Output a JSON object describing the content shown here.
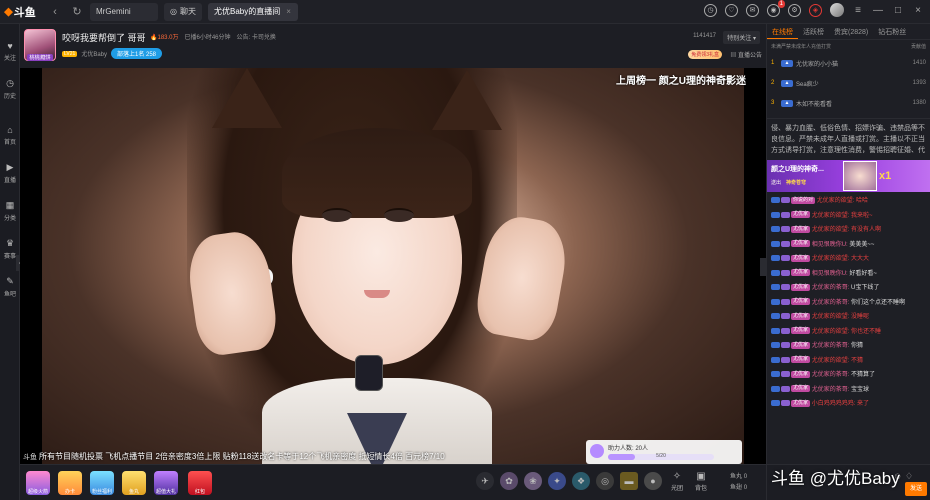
{
  "titlebar": {
    "app": "斗鱼",
    "tabs": [
      {
        "label": "MrGemini"
      },
      {
        "label": "聊天"
      },
      {
        "label": "尤优Baby的直播间"
      }
    ]
  },
  "sidebar": {
    "items": [
      {
        "icon": "follow-icon",
        "label": "关注"
      },
      {
        "icon": "history-icon",
        "label": "历史"
      },
      {
        "icon": "home-icon",
        "label": "首页"
      },
      {
        "icon": "live-icon",
        "label": "直播"
      },
      {
        "icon": "category-icon",
        "label": "分类"
      },
      {
        "icon": "trophy-icon",
        "label": "赛事"
      },
      {
        "icon": "fishbar-icon",
        "label": "鱼吧"
      }
    ]
  },
  "header": {
    "title": "咬呀我要帮倒了 哥哥",
    "follow": "关注",
    "heat": "183.0万",
    "duration": "已播6小时46分钟",
    "announcement": "公告: 卡司兑换",
    "streamer": "尤优Baby",
    "level_badge": "LV21",
    "hour_rank": "部落上1名 258",
    "room_id": "1141417",
    "special_follow": "特别关注",
    "gift_tag": "免费领3礼盒",
    "live_notice": "直播公告",
    "avatar_label": "桃桃|糖饼"
  },
  "video": {
    "weekly": "上周榜一 颜之U理的神奇影迷",
    "ticker_prefix": "斗鱼",
    "ticker": "所有节目随机投票 飞机点播节目 2倍亲密度3倍上限 贴粉118送改名卡等于12个飞机亲密度 抵短情长4倍 百元榜7/10",
    "popup_title": "助力人数: 20人",
    "popup_progress_text": "5/20",
    "popup_progress": 0.25
  },
  "bottombar": {
    "gifts": [
      {
        "label": "超级火箭"
      },
      {
        "label": "办卡"
      },
      {
        "label": "粉丝福利"
      },
      {
        "label": "鱼丸"
      },
      {
        "label": "超值大礼"
      },
      {
        "label": "红包"
      }
    ],
    "tools": [
      {
        "label": "光团"
      },
      {
        "label": "背包"
      }
    ],
    "cash_label": "鱼丸",
    "cash_value": "0",
    "coin_label": "鱼翅",
    "coin_value": "0"
  },
  "rightpanel": {
    "tabs": [
      "在线榜",
      "活跃榜",
      "贵宾(2828)",
      "钻石粉丝"
    ],
    "rank_header": "未满严禁未成年人充值打赏",
    "rank_contrib_label": "贡献值",
    "ranks": [
      {
        "no": "1",
        "name": "尤优家的小小猫",
        "value": "1410"
      },
      {
        "no": "2",
        "name": "Sea疯少",
        "value": "1393"
      },
      {
        "no": "3",
        "name": "木如不能看看",
        "value": "1380"
      }
    ],
    "notice": "侵、暴力血腥、低俗色情、招嫖诈骗、违禁品等不良信息。严禁未成年人直播或打赏。主播以不正当方式诱导打赏，注意理性消费，警惕招聘征婚、代",
    "banner": {
      "title": "颜之U理的神奇...",
      "sub1": "送出",
      "sub2": "神奇苍穹",
      "mult": "x1"
    },
    "chat": [
      {
        "fans": "你说的对",
        "name": "尤优家的欲望:",
        "text": "哈哈",
        "red": true
      },
      {
        "fans": "尤优家",
        "name": "尤优家的欲望:",
        "text": "我来啦~",
        "red": true
      },
      {
        "fans": "尤优家",
        "name": "尤优家的欲望:",
        "text": "有没有人啊",
        "red": true
      },
      {
        "fans": "尤优家",
        "name": "相见恨晚你U:",
        "text": "美美美~~",
        "red": false
      },
      {
        "fans": "尤优家",
        "name": "尤优家的欲望:",
        "text": "大大大",
        "red": true
      },
      {
        "fans": "尤优家",
        "name": "相见恨晚你U:",
        "text": "好看好看~",
        "red": false
      },
      {
        "fans": "尤优家",
        "name": "尤优家的茶哥:",
        "text": "U宝下线了",
        "red": false
      },
      {
        "fans": "尤优家",
        "name": "尤优家的茶哥:",
        "text": "你们这个点还不睡啊",
        "red": false
      },
      {
        "fans": "尤优家",
        "name": "尤优家的欲望:",
        "text": "没睡呢",
        "red": true
      },
      {
        "fans": "尤优家",
        "name": "尤优家的欲望:",
        "text": "你也还不睡",
        "red": true
      },
      {
        "fans": "尤优家",
        "name": "尤优家的茶哥:",
        "text": "你猜",
        "red": false
      },
      {
        "fans": "尤优家",
        "name": "尤优家的欲望:",
        "text": "不猜",
        "red": true
      },
      {
        "fans": "尤优家",
        "name": "尤优家的茶哥:",
        "text": "不猜算了",
        "red": false
      },
      {
        "fans": "尤优家",
        "name": "尤优家的茶哥:",
        "text": "宝宝球",
        "red": false
      },
      {
        "fans": "尤优家",
        "name": "小白鸡鸡鸡鸡鸡:",
        "text": "来了",
        "red": true
      }
    ],
    "send": "发送"
  },
  "watermark": "斗鱼 @尤优Baby"
}
